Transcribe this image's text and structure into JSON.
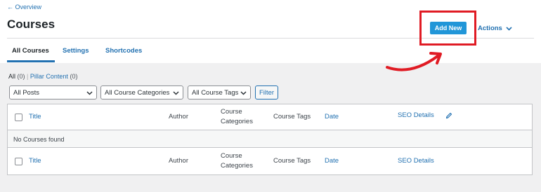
{
  "header": {
    "back_link": "← Overview",
    "title": "Courses",
    "add_new": "Add New",
    "actions": "Actions"
  },
  "tabs": [
    {
      "label": "All Courses",
      "active": true
    },
    {
      "label": "Settings",
      "active": false
    },
    {
      "label": "Shortcodes",
      "active": false
    }
  ],
  "views": {
    "all_label": "All",
    "all_count": "(0)",
    "separator": "|",
    "pillar_label": "Pillar Content",
    "pillar_count": "(0)"
  },
  "filters": {
    "posts": "All Posts",
    "categories": "All Course Categories",
    "tags": "All Course Tags",
    "button": "Filter"
  },
  "table": {
    "columns": {
      "title": "Title",
      "author": "Author",
      "categories_line1": "Course",
      "categories_line2": "Categories",
      "tags": "Course Tags",
      "date": "Date",
      "seo": "SEO Details"
    },
    "empty_message": "No Courses found"
  },
  "colors": {
    "accent": "#2271b1",
    "button": "#2196d8",
    "highlight": "#e01b24"
  }
}
